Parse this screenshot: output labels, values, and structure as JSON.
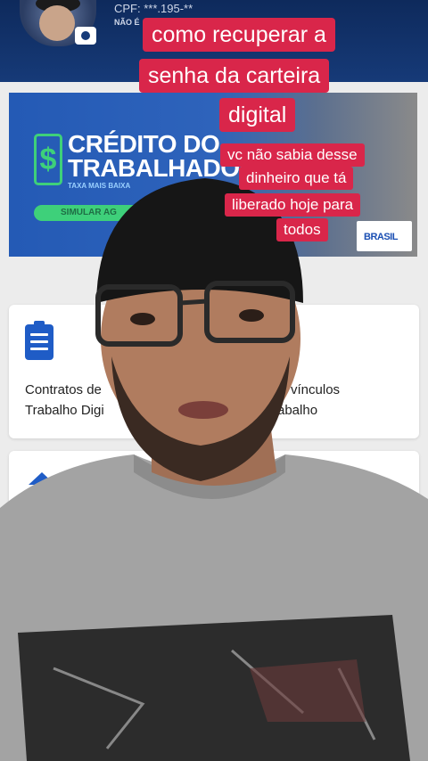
{
  "header": {
    "cpf_text": "CPF: ***.195-**",
    "status_text": "NÃO É"
  },
  "banner": {
    "title_line1": "CRÉDITO DO",
    "title_line2": "TRABALHADOR",
    "subtitle": "TAXA MAIS BAIXA",
    "button_label": "SIMULAR AG",
    "logo_text": "BRASIL",
    "icon": "dollar-icon"
  },
  "cards": [
    {
      "icon": "clipboard-icon",
      "line1": "Contratos de",
      "line2": "Trabalho Digi",
      "right_line1": "os vínculos",
      "right_line2": "rabalho"
    },
    {
      "icon": "upload-icon"
    }
  ],
  "captions": {
    "main": [
      "como recuperar a",
      "senha da carteira",
      "digital"
    ],
    "sub": [
      "vc não sabia desse",
      "dinheiro que tá",
      "liberado hoje para",
      "todos"
    ]
  },
  "colors": {
    "caption_bg": "#d9264a",
    "header_bg": "#0e2a5c",
    "accent_green": "#3ed07a",
    "brand_blue": "#1f5cc6"
  }
}
